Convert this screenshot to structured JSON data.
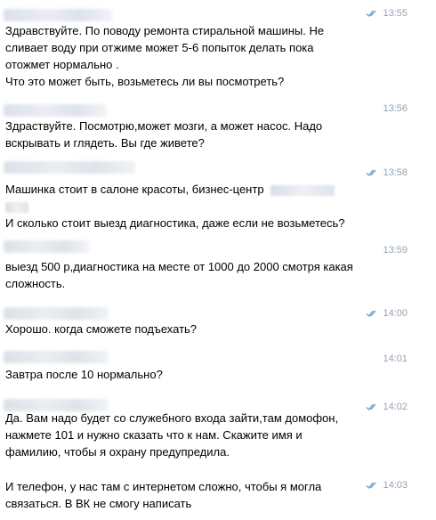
{
  "messages": [
    {
      "time": "13:55",
      "read": true,
      "lines": [
        "Здравствуйте. По поводу ремонта стиральной машины. Не",
        "сливает воду при отжиме может 5-6 попыток делать пока",
        "отожмет нормально .",
        "Что это может быть, возьметесь ли вы посмотреть?"
      ]
    },
    {
      "time": "13:56",
      "read": false,
      "lines": [
        "Здраствуйте. Посмотрю,может мозги, а может насос. Надо",
        "вскрывать и глядеть. Вы где живете?"
      ]
    },
    {
      "time": "13:58",
      "read": true,
      "lines": [
        "Машинка стоит в салоне красоты, бизнес-центр",
        "",
        "И сколько стоит выезд диагностика, даже если не возьметесь?"
      ]
    },
    {
      "time": "13:59",
      "read": false,
      "lines": [
        "выезд 500 р,диагностика на месте от 1000 до 2000 смотря какая",
        "сложность."
      ]
    },
    {
      "time": "14:00",
      "read": true,
      "lines": [
        "Хорошо. когда сможете подъехать?"
      ]
    },
    {
      "time": "14:01",
      "read": false,
      "lines": [
        "Завтра после 10 нормально?"
      ]
    },
    {
      "time": "14:02",
      "read": true,
      "lines": [
        "Да. Вам надо будет со служебного входа зайти,там домофон,",
        "нажмете 101 и нужно сказать что к нам. Скажите имя и",
        "фамилию, чтобы я охрану предупредила."
      ]
    },
    {
      "time": "14:03",
      "read": true,
      "lines": [
        "И телефон, у нас там с интернетом сложно, чтобы я могла",
        "связаться. В ВК не смогу написать"
      ]
    }
  ]
}
